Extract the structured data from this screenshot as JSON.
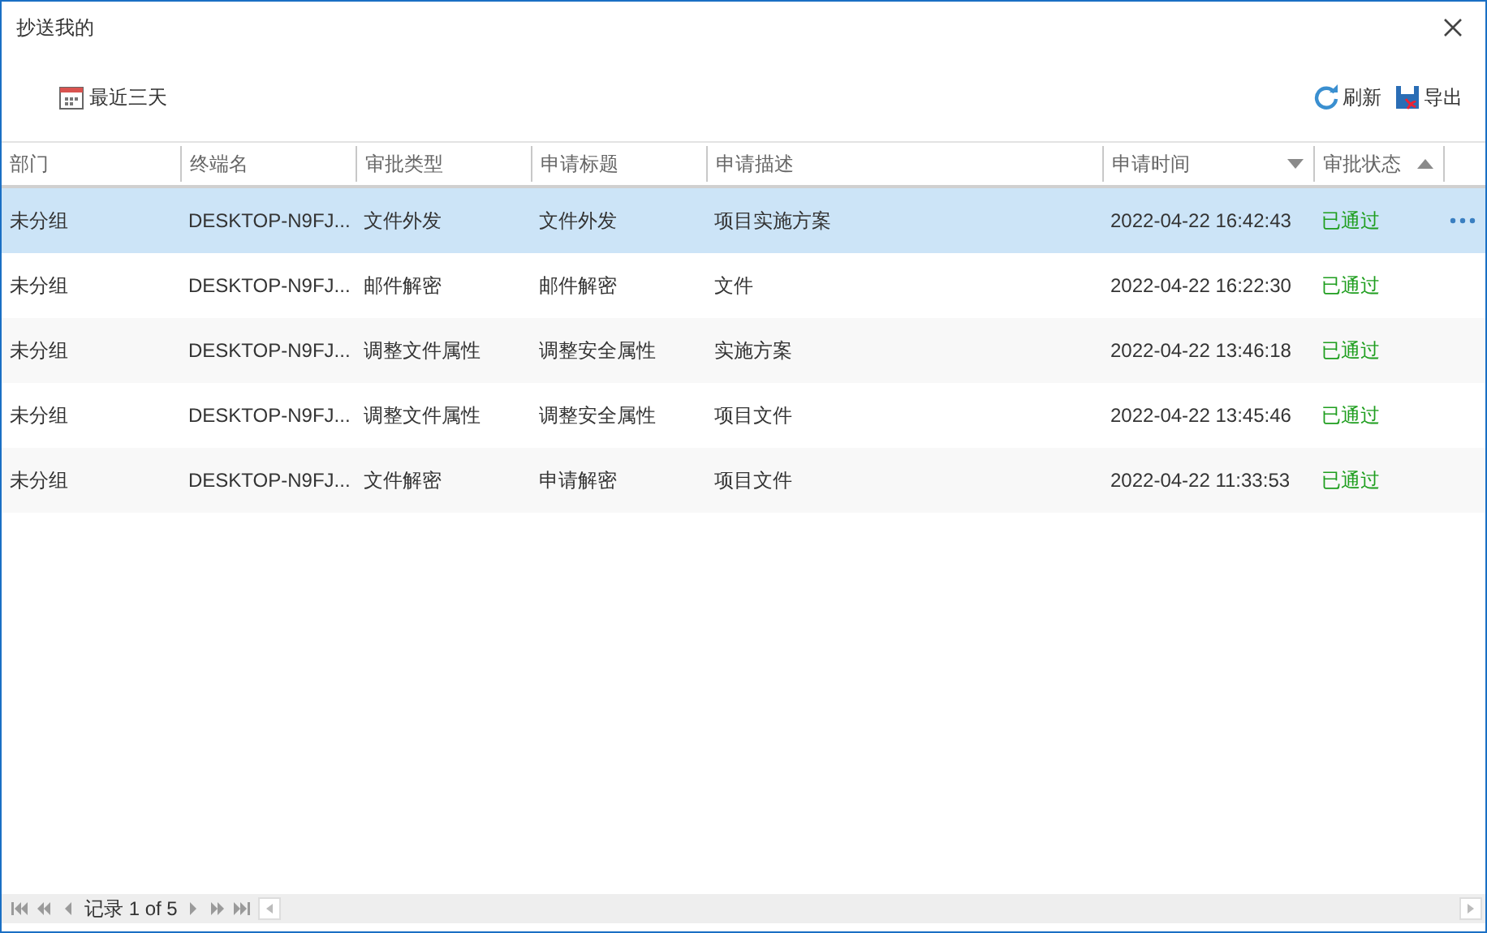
{
  "window": {
    "title": "抄送我的"
  },
  "toolbar": {
    "filter": "最近三天",
    "refresh": "刷新",
    "export": "导出"
  },
  "table": {
    "columns": [
      {
        "label": "部门",
        "sorted_descending": false,
        "sorted_ascending": false
      },
      {
        "label": "终端名",
        "sorted_descending": false,
        "sorted_ascending": false
      },
      {
        "label": "审批类型",
        "sorted_descending": false,
        "sorted_ascending": false
      },
      {
        "label": "申请标题",
        "sorted_descending": false,
        "sorted_ascending": false
      },
      {
        "label": "申请描述",
        "sorted_descending": false,
        "sorted_ascending": false
      },
      {
        "label": "申请时间",
        "sorted_descending": true,
        "sorted_ascending": false
      },
      {
        "label": "审批状态",
        "sorted_descending": false,
        "sorted_ascending": true
      }
    ],
    "rows": [
      {
        "selected": true,
        "cells": [
          "未分组",
          "DESKTOP-N9FJ...",
          "文件外发",
          "文件外发",
          "项目实施方案",
          "2022-04-22 16:42:43",
          "已通过"
        ]
      },
      {
        "selected": false,
        "cells": [
          "未分组",
          "DESKTOP-N9FJ...",
          "邮件解密",
          "邮件解密",
          "文件",
          "2022-04-22 16:22:30",
          "已通过"
        ]
      },
      {
        "selected": false,
        "cells": [
          "未分组",
          "DESKTOP-N9FJ...",
          "调整文件属性",
          "调整安全属性",
          "实施方案",
          "2022-04-22 13:46:18",
          "已通过"
        ]
      },
      {
        "selected": false,
        "cells": [
          "未分组",
          "DESKTOP-N9FJ...",
          "调整文件属性",
          "调整安全属性",
          "项目文件",
          "2022-04-22 13:45:46",
          "已通过"
        ]
      },
      {
        "selected": false,
        "cells": [
          "未分组",
          "DESKTOP-N9FJ...",
          "文件解密",
          "申请解密",
          "项目文件",
          "2022-04-22 11:33:53",
          "已通过"
        ]
      }
    ]
  },
  "pager": {
    "label": "记录 1 of 5"
  }
}
